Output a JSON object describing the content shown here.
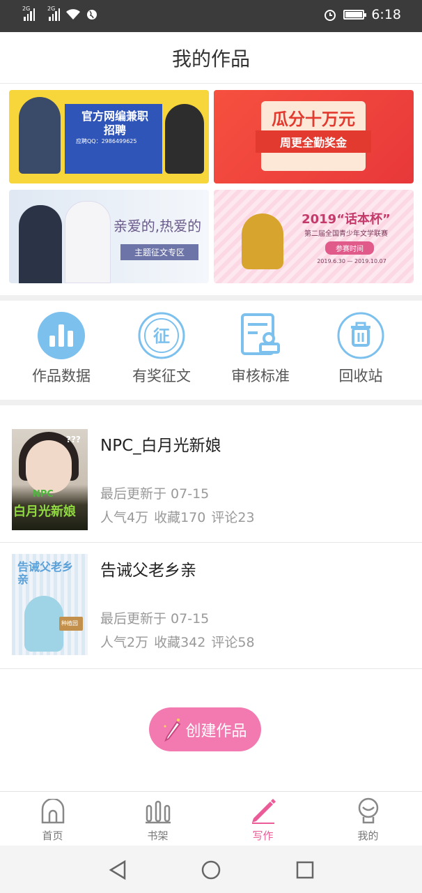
{
  "status_bar": {
    "net1": "2G",
    "net2": "2G",
    "time": "6:18"
  },
  "header": {
    "title": "我的作品"
  },
  "banners": [
    {
      "title": "官方网编兼职",
      "subtitle": "招聘",
      "extra": "应聘QQ：2986499625"
    },
    {
      "title": "瓜分十万元",
      "subtitle": "周更全勤奖金"
    },
    {
      "title": "亲爱的,热爱的",
      "subtitle": "主题征文专区"
    },
    {
      "title": "2019“话本杯”",
      "subtitle": "第二届全国青少年文学联赛",
      "tag": "参赛时间",
      "dates": "2019.6.30 — 2019.10.07"
    }
  ],
  "actions": [
    {
      "label": "作品数据",
      "icon": "bar-chart-icon"
    },
    {
      "label": "有奖征文",
      "icon": "contest-icon"
    },
    {
      "label": "审核标准",
      "icon": "review-standard-icon"
    },
    {
      "label": "回收站",
      "icon": "trash-icon"
    }
  ],
  "works": [
    {
      "title": "NPC_白月光新娘",
      "updated": "最后更新于 07-15",
      "stats": {
        "popularity": "人气4万",
        "favorites": "收藏170",
        "comments": "评论23"
      },
      "cover": {
        "tag": "NPC",
        "title": "白月光新娘",
        "side": "???"
      }
    },
    {
      "title": "告诫父老乡亲",
      "updated": "最后更新于 07-15",
      "stats": {
        "popularity": "人气2万",
        "favorites": "收藏342",
        "comments": "评论58"
      },
      "cover": {
        "title": "告诫父老乡亲",
        "sign": "种植园"
      }
    }
  ],
  "create_button": {
    "label": "创建作品"
  },
  "tabbar": [
    {
      "label": "首页",
      "icon": "home-icon"
    },
    {
      "label": "书架",
      "icon": "bookshelf-icon"
    },
    {
      "label": "写作",
      "icon": "pen-icon",
      "active": true
    },
    {
      "label": "我的",
      "icon": "profile-icon"
    }
  ],
  "colors": {
    "accent": "#ea5b97",
    "button": "#f27ab0",
    "icon_blue": "#5aa8e0",
    "muted": "#999999"
  }
}
